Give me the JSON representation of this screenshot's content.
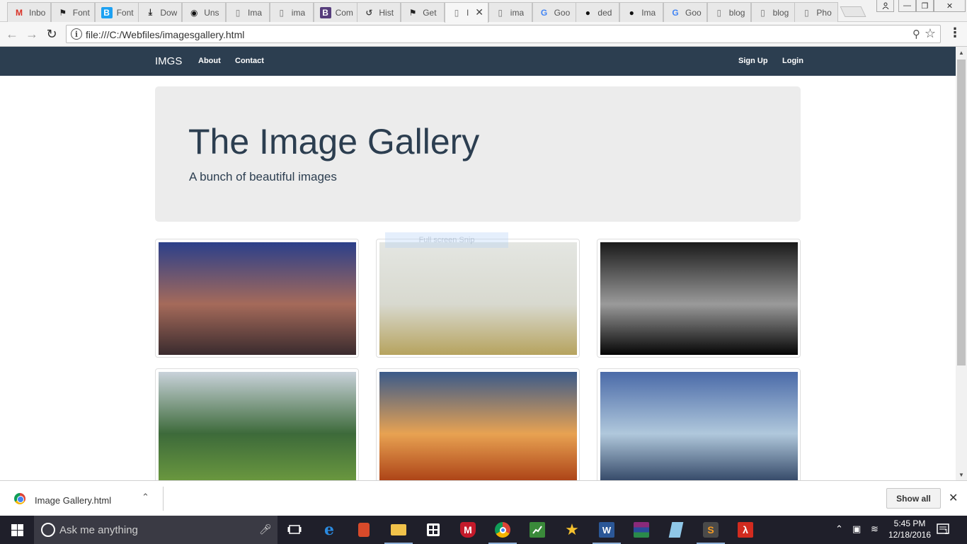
{
  "browser": {
    "tabs": [
      {
        "title": "Inbo",
        "icon": "gmail-icon",
        "color": "#d93025"
      },
      {
        "title": "Font",
        "icon": "flag-icon",
        "color": "#222222"
      },
      {
        "title": "Font",
        "icon": "bootstrap-b-icon",
        "color": "#1da1f2"
      },
      {
        "title": "Dow",
        "icon": "download-icon",
        "color": "#222222"
      },
      {
        "title": "Uns",
        "icon": "camera-icon",
        "color": "#111111"
      },
      {
        "title": "Ima",
        "icon": "page-icon",
        "color": "#777777"
      },
      {
        "title": "ima",
        "icon": "page-icon",
        "color": "#777777"
      },
      {
        "title": "Com",
        "icon": "bootstrap-b-icon",
        "color": "#563d7c"
      },
      {
        "title": "Hist",
        "icon": "history-icon",
        "color": "#444444"
      },
      {
        "title": "Get",
        "icon": "flag-icon",
        "color": "#222222"
      },
      {
        "title": "I",
        "icon": "page-icon",
        "color": "#777777",
        "active": true
      },
      {
        "title": "ima",
        "icon": "page-icon",
        "color": "#777777"
      },
      {
        "title": "Goo",
        "icon": "google-g-icon",
        "color": "#4285f4"
      },
      {
        "title": "ded",
        "icon": "github-icon",
        "color": "#111111"
      },
      {
        "title": "Ima",
        "icon": "github-icon",
        "color": "#111111"
      },
      {
        "title": "Goo",
        "icon": "google-g-icon",
        "color": "#4285f4"
      },
      {
        "title": "blog",
        "icon": "page-icon",
        "color": "#777777"
      },
      {
        "title": "blog",
        "icon": "page-icon",
        "color": "#777777"
      },
      {
        "title": "Pho",
        "icon": "page-icon",
        "color": "#777777"
      }
    ],
    "url": "file:///C:/Webfiles/imagesgallery.html"
  },
  "site": {
    "brand": "IMGS",
    "nav_left": [
      "About",
      "Contact"
    ],
    "nav_right": [
      "Sign Up",
      "Login"
    ],
    "hero_title": "The Image Gallery",
    "hero_subtitle": "A bunch of beautiful images",
    "overlay_text": "Full screen Snip",
    "images": [
      {
        "name": "golden-gate-bridge-image",
        "palette": [
          "#2b3f8a",
          "#a56a5a",
          "#3a2b2e"
        ]
      },
      {
        "name": "foggy-field-image",
        "palette": [
          "#e4e6e2",
          "#d8d9cf",
          "#b6a35e"
        ]
      },
      {
        "name": "abstract-architecture-image",
        "palette": [
          "#1a1a1a",
          "#9a9a9a",
          "#050505"
        ]
      },
      {
        "name": "mountain-meadow-image",
        "palette": [
          "#c9d2da",
          "#3d6a3a",
          "#6d9b3f"
        ]
      },
      {
        "name": "sunset-clouds-image",
        "palette": [
          "#3a5a8a",
          "#e8a252",
          "#a83c12"
        ]
      },
      {
        "name": "ocean-horizon-image",
        "palette": [
          "#4a6aa8",
          "#b0c8dc",
          "#2c4060"
        ]
      }
    ]
  },
  "download_bar": {
    "filename": "Image Gallery.html",
    "show_all": "Show all"
  },
  "taskbar": {
    "search_placeholder": "Ask me anything",
    "time": "5:45 PM",
    "date": "12/18/2016",
    "notification_count": "1"
  }
}
